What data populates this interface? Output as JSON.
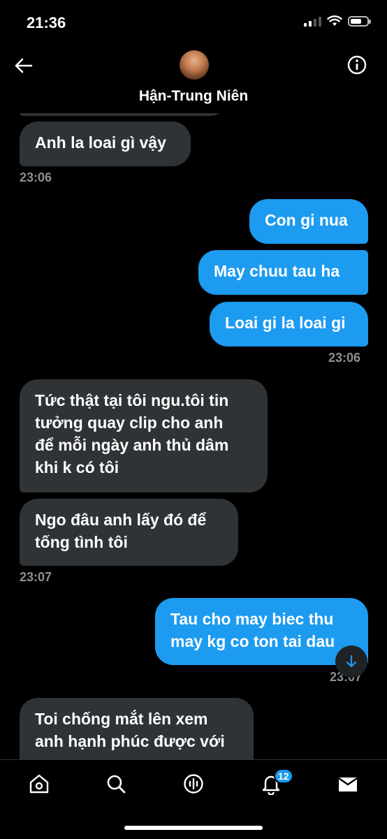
{
  "status": {
    "time": "21:36"
  },
  "header": {
    "contact_name": "Hận-Trung Niên"
  },
  "messages": [
    {
      "direction": "in",
      "text": "Anh la loai gì vậy"
    },
    {
      "time": "23:06"
    },
    {
      "direction": "out",
      "text": "Con gi nua"
    },
    {
      "direction": "out",
      "text": "May chuu tau ha"
    },
    {
      "direction": "out",
      "text": "Loai gi la loai gi"
    },
    {
      "time": "23:06"
    },
    {
      "direction": "in",
      "lines": [
        "Tức thật tại tôi ngu.tôi tin",
        "tưởng quay clip cho anh",
        "để mỗi ngày anh thủ dâm",
        "khi k có tôi"
      ]
    },
    {
      "direction": "in",
      "lines": [
        "Ngo đâu anh lấy đó để",
        "tống tình tôi"
      ]
    },
    {
      "time": "23:07"
    },
    {
      "direction": "out",
      "lines": [
        "Tau cho may biec thu",
        "may kg co ton tai dau"
      ]
    },
    {
      "time": "23:07"
    },
    {
      "direction": "in",
      "lines": [
        "Toi chống mắt lên xem",
        "anh hạnh phúc được với"
      ]
    }
  ],
  "nav": {
    "items": [
      "home-icon",
      "search-icon",
      "spaces-icon",
      "notifications-icon",
      "messages-icon"
    ],
    "notifications_badge": "12"
  },
  "colors": {
    "outgoing": "#1d9bf0",
    "incoming": "#2f3336",
    "background": "#000000"
  }
}
